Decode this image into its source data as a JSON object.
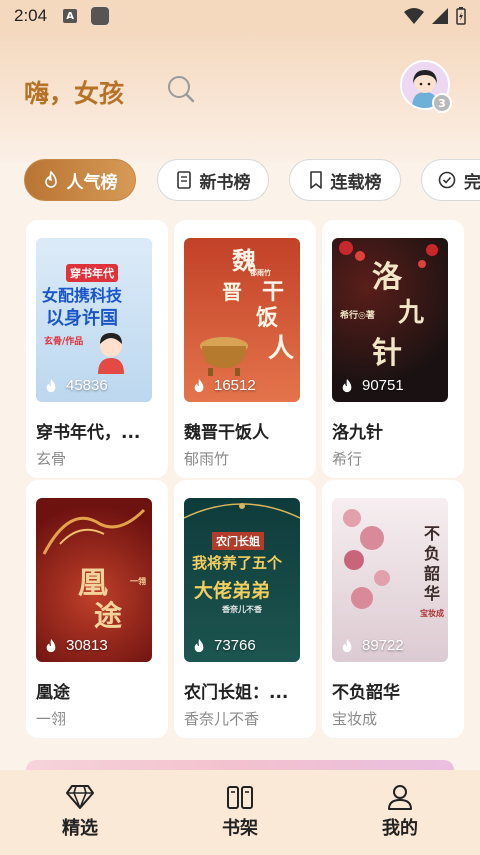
{
  "status_bar": {
    "time": "2:04",
    "a_icon": "A"
  },
  "header": {
    "greeting": "嗨，女孩",
    "avatar_badge": "3"
  },
  "tabs": [
    {
      "label": "人气榜",
      "icon": "flame-icon",
      "active": true
    },
    {
      "label": "新书榜",
      "icon": "book-icon",
      "active": false
    },
    {
      "label": "连载榜",
      "icon": "bookmark-icon",
      "active": false
    },
    {
      "label": "完",
      "icon": "check-circle-icon",
      "active": false
    }
  ],
  "books": [
    {
      "title": "穿书年代，...",
      "author": "玄骨",
      "count": "45836",
      "cover_colors": [
        "#cfe3f6",
        "#e9f2fb"
      ],
      "cover_lines": [
        "穿书年代",
        "女配携科技",
        "以身许国"
      ],
      "cover_small": "玄骨/作品"
    },
    {
      "title": "魏晋干饭人",
      "author": "郁雨竹",
      "count": "16512",
      "cover_colors": [
        "#c7462d",
        "#e98a5a"
      ],
      "cover_lines": [
        "魏",
        "晋",
        "干",
        "饭",
        "人"
      ],
      "cover_small": "郁雨竹"
    },
    {
      "title": "洛九针",
      "author": "希行",
      "count": "90751",
      "cover_colors": [
        "#1b1413",
        "#4a1f1a"
      ],
      "cover_lines": [
        "洛",
        "九",
        "针"
      ],
      "cover_small": "希行◎著"
    },
    {
      "title": "凰途",
      "author": "一翎",
      "count": "30813",
      "cover_colors": [
        "#7a1512",
        "#b8351f"
      ],
      "cover_lines": [
        "凰",
        "途"
      ],
      "cover_small": "一翎"
    },
    {
      "title": "农门长姐：...",
      "author": "香奈儿不香",
      "count": "73766",
      "cover_colors": [
        "#0c3a3a",
        "#1e5a52"
      ],
      "cover_lines": [
        "农门长姐",
        "我将养了五个",
        "大佬弟弟"
      ],
      "cover_small": "香奈儿不香"
    },
    {
      "title": "不负韶华",
      "author": "宝妆成",
      "count": "89722",
      "cover_colors": [
        "#f3e9ec",
        "#d9c8cf"
      ],
      "cover_lines": [
        "不",
        "负",
        "韶",
        "华"
      ],
      "cover_small": "宝妆成"
    }
  ],
  "bottom_nav": [
    {
      "label": "精选",
      "icon": "diamond-icon"
    },
    {
      "label": "书架",
      "icon": "bookshelf-icon"
    },
    {
      "label": "我的",
      "icon": "profile-icon"
    }
  ],
  "colors": {
    "accent": "#b87433",
    "accent_light": "#d79a57"
  }
}
